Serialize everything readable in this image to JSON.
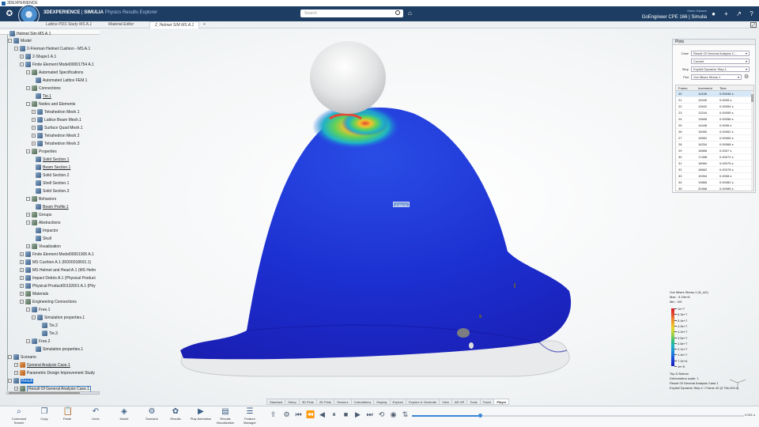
{
  "os": {
    "title": "3DEXPERIENCE"
  },
  "header": {
    "brand": "3DEXPERIENCE",
    "separator": " | ",
    "product": "SIMULIA",
    "app": "Physics Results Explorer",
    "search_placeholder": "Search",
    "role_caption": "Mario Salazar",
    "role": "GoEngineer CPE 166 | Simulia"
  },
  "tabs": [
    {
      "label": "Lattice PDS Study MS A.1",
      "active": false
    },
    {
      "label": "Material Editor",
      "active": false
    },
    {
      "label": "2_Helmet SIM MS A.1",
      "active": true
    },
    {
      "label": "+",
      "active": false
    }
  ],
  "tree": {
    "top": "Helmet Sim MS A.1",
    "nodes": [
      {
        "label": "Model"
      },
      {
        "label": "2-Fireman Helmet Cushion - MS A.1"
      },
      {
        "label": "2-Shape1 A.1"
      },
      {
        "label": "Finite Element Model00001754 A.1"
      },
      {
        "label": "Automated Specifications"
      },
      {
        "label": "Automated Lattice FEM.1"
      },
      {
        "label": "Connections"
      },
      {
        "label": "Tie.1"
      },
      {
        "label": "Nodes and Elements"
      },
      {
        "label": "Tetrahedron Mesh.1"
      },
      {
        "label": "Lattice Beam Mesh.1"
      },
      {
        "label": "Surface Quad Mesh.1"
      },
      {
        "label": "Tetrahedron Mesh.2"
      },
      {
        "label": "Tetrahedron Mesh.3"
      },
      {
        "label": "Properties"
      },
      {
        "label": "Solid Section.1"
      },
      {
        "label": "Beam Section.1"
      },
      {
        "label": "Solid Section.2"
      },
      {
        "label": "Shell Section.1"
      },
      {
        "label": "Solid Section.3"
      },
      {
        "label": "Behaviors"
      },
      {
        "label": "Beam Profile.1"
      },
      {
        "label": "Groups"
      },
      {
        "label": "Abstractions"
      },
      {
        "label": "Impactor"
      },
      {
        "label": "Skull"
      },
      {
        "label": "Visualization"
      },
      {
        "label": "Finite Element Model00001905 A.1"
      },
      {
        "label": "MS Cushion A.1 (RD00018691.1)"
      },
      {
        "label": "MS Helmet and Head A.1 (MS Helm"
      },
      {
        "label": "Impact Debris A.1 (Physical Product"
      },
      {
        "label": "Physical Product00132601 A.1 (Phy"
      },
      {
        "label": "Materials"
      },
      {
        "label": "Engineering Connections"
      },
      {
        "label": "Free.1"
      },
      {
        "label": "Simulation properties.1"
      },
      {
        "label": "Tie.2"
      },
      {
        "label": "Tie.3"
      },
      {
        "label": "Free.2"
      },
      {
        "label": "Simulation properties.1"
      },
      {
        "label": "Scenario"
      },
      {
        "label": "General Analysis Case.1"
      },
      {
        "label": "Parametric Design Improvement Study"
      },
      {
        "label": "Result"
      },
      {
        "label": "Result Of General Analysis Case.1"
      }
    ]
  },
  "viewport": {
    "probe_label": "3.32e+5"
  },
  "plots": {
    "title": "Plots",
    "case_label": "Case",
    "case_value": "Result Of General Analysic C...",
    "current_value": "Current",
    "step_label": "Step",
    "step_value": "Explicit Dynamic Step.1",
    "plot_label": "Plot",
    "plot_value": "Von Mises Stress.1",
    "columns": [
      "Frame",
      "Increment",
      "Time"
    ],
    "rows": [
      {
        "frame": "20",
        "inc": "11438",
        "time": "0.00046 s"
      },
      {
        "frame": "21",
        "inc": "12040",
        "time": "0.0005 s"
      },
      {
        "frame": "22",
        "inc": "12642",
        "time": "0.00054 s"
      },
      {
        "frame": "23",
        "inc": "13244",
        "time": "0.00055 s"
      },
      {
        "frame": "24",
        "inc": "13846",
        "time": "0.00058 s"
      },
      {
        "frame": "25",
        "inc": "14448",
        "time": "0.0006 s"
      },
      {
        "frame": "26",
        "inc": "15050",
        "time": "0.00062 s"
      },
      {
        "frame": "27",
        "inc": "15652",
        "time": "0.00065 s"
      },
      {
        "frame": "28",
        "inc": "16254",
        "time": "0.00068 s"
      },
      {
        "frame": "29",
        "inc": "16856",
        "time": "0.0007 s"
      },
      {
        "frame": "30",
        "inc": "17458",
        "time": "0.00072 s"
      },
      {
        "frame": "31",
        "inc": "18060",
        "time": "0.00075 s"
      },
      {
        "frame": "32",
        "inc": "18662",
        "time": "0.00078 s"
      },
      {
        "frame": "33",
        "inc": "19264",
        "time": "0.0008 s"
      },
      {
        "frame": "34",
        "inc": "19866",
        "time": "0.00082 s"
      },
      {
        "frame": "35",
        "inc": "20468",
        "time": "0.00085 s"
      }
    ]
  },
  "legend": {
    "title": "Von Mises Stress.1 (N_m2)",
    "max": "Max : 3.19e+8",
    "min": "Min : 0/9",
    "ticks": [
      "1e+7",
      "6.3e+7",
      "5.4e+7",
      "4.9e+7",
      "4.2e+7",
      "3.5e+7",
      "2.8e+7",
      "2.1e+7",
      "1.4e+7",
      "7.2e+6",
      "1e+5"
    ],
    "colors": [
      "#d7191c",
      "#f09b2a",
      "#e8d52c",
      "#2fc07a",
      "#1fb3c7",
      "#1d7fe0",
      "#1a1ab8"
    ],
    "info1": "Top & Bottom",
    "info2": "Deformation scale: 1",
    "info3": "Result Of General Analysis Case.1",
    "info4": "Explicit Dynamic Step.1 / Frame 40 (0.75e-004 s)"
  },
  "command_bar": {
    "items": [
      {
        "label": "Command Search",
        "icon": "search-icon"
      },
      {
        "label": "Copy",
        "icon": "copy-icon"
      },
      {
        "label": "Paste",
        "icon": "paste-icon"
      },
      {
        "label": "Undo",
        "icon": "undo-icon"
      },
      {
        "label": "Model",
        "icon": "model-icon"
      },
      {
        "label": "Scenario",
        "icon": "scenario-icon"
      },
      {
        "label": "Results",
        "icon": "results-icon"
      },
      {
        "label": "Play Animation",
        "icon": "play-animation-icon"
      },
      {
        "label": "Results Visualization",
        "icon": "results-visualization-icon"
      },
      {
        "label": "Feature Manager",
        "icon": "feature-manager-icon"
      }
    ],
    "sections": [
      "Standard",
      "Setup",
      "3D Plots",
      "2D Plots",
      "Sensors",
      "Calculations",
      "Display",
      "Explore",
      "Explore & Generate",
      "View",
      "AR-VR",
      "Tools",
      "Touch",
      "Player"
    ],
    "active_section": "Player",
    "player_time": "0.001 s",
    "player_progress": 0.2
  }
}
